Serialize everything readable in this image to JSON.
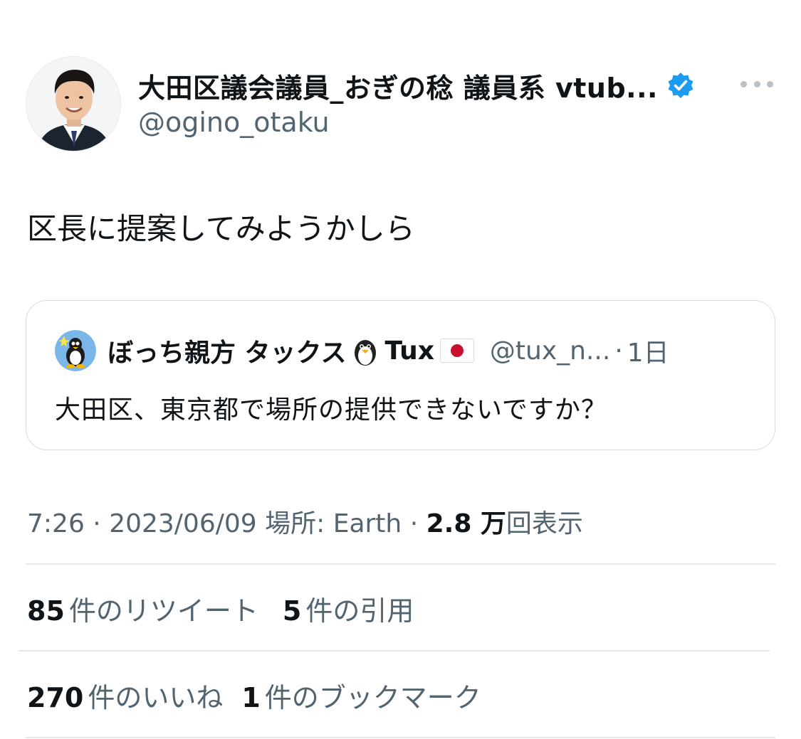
{
  "author": {
    "display_name": "大田区議会議員_おぎの稔 議員系 vtub...",
    "handle": "@ogino_otaku",
    "verified": true,
    "verified_color": "#1d9bf0"
  },
  "tweet": {
    "text": "区長に提案してみようかしら"
  },
  "quote": {
    "name": "ぼっち親方 タックス",
    "name_suffix": "Tux",
    "handle": "@tux_n...",
    "separator": "·",
    "time": "1日",
    "text": "大田区、東京都で場所の提供できないですか？"
  },
  "meta": {
    "time": "7:26",
    "dot1": " · ",
    "date": "2023/06/09",
    "location": " 場所: Earth",
    "dot2": " · ",
    "views_count": "2.8 万",
    "views_label": "回表示"
  },
  "stats": {
    "retweets_count": "85",
    "retweets_label": "件のリツイート",
    "quotes_count": "5",
    "quotes_label": "件の引用",
    "likes_count": "270",
    "likes_label": "件のいいね",
    "bookmarks_count": "1",
    "bookmarks_label": "件のブックマーク"
  },
  "colors": {
    "text_primary": "#0f1419",
    "text_secondary": "#536471",
    "border": "#d7dde2",
    "accent": "#1d9bf0"
  }
}
